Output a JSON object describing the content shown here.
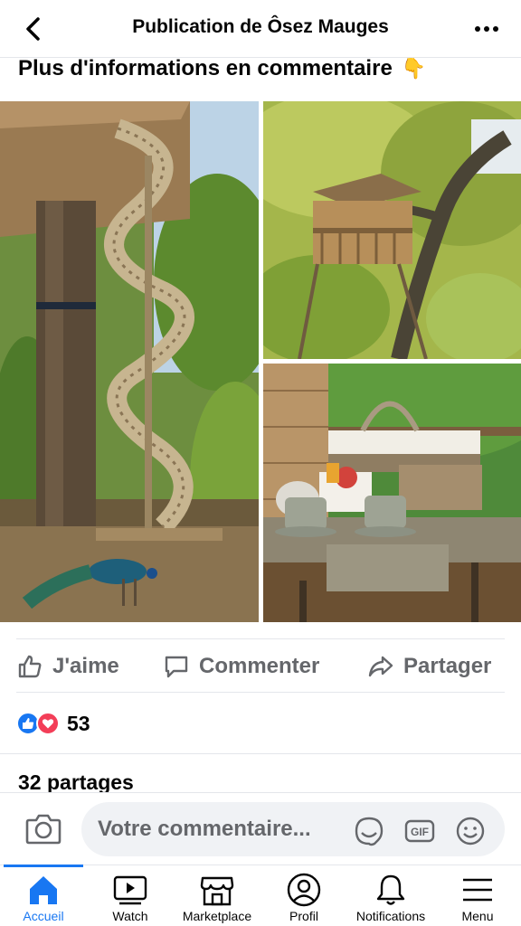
{
  "header": {
    "title": "Publication de Ôsez Mauges"
  },
  "post": {
    "text": "Plus d'informations en commentaire",
    "emoji": "👇"
  },
  "actions": {
    "like": "J'aime",
    "comment": "Commenter",
    "share": "Partager"
  },
  "reactions": {
    "count": "53"
  },
  "shares": {
    "label": "32 partages"
  },
  "comment_bar": {
    "placeholder": "Votre commentaire..."
  },
  "nav": {
    "items": [
      {
        "label": "Accueil",
        "icon": "home-icon",
        "active": true
      },
      {
        "label": "Watch",
        "icon": "video-icon"
      },
      {
        "label": "Marketplace",
        "icon": "store-icon"
      },
      {
        "label": "Profil",
        "icon": "profile-icon"
      },
      {
        "label": "Notifications",
        "icon": "bell-icon"
      },
      {
        "label": "Menu",
        "icon": "menu-icon"
      }
    ]
  },
  "colors": {
    "accent": "#1877f2",
    "love": "#f33e58",
    "secondary_text": "#65676b"
  }
}
